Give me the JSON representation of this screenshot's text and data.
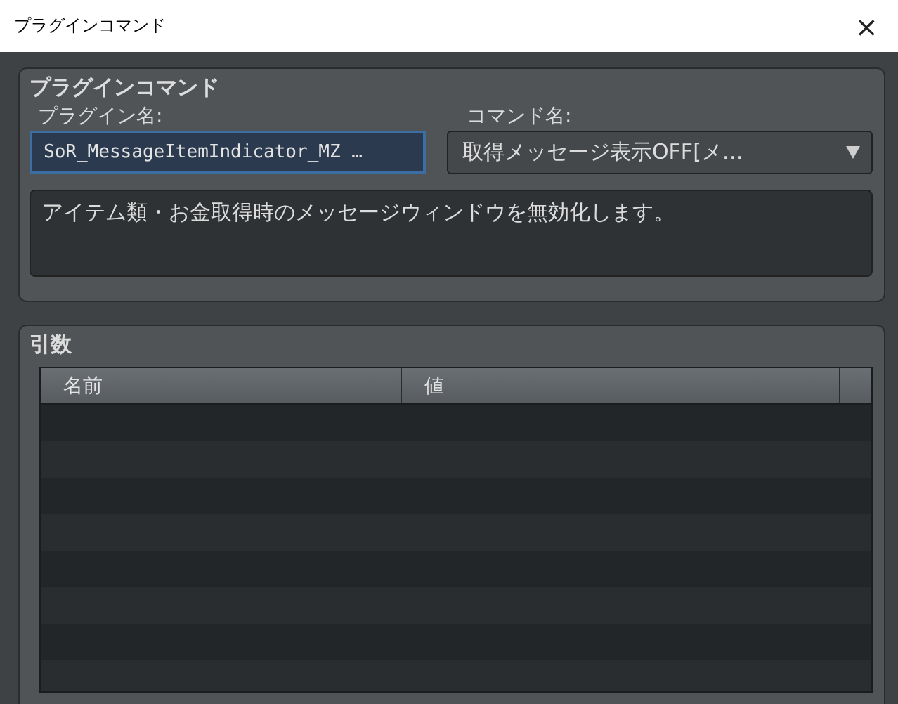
{
  "window": {
    "title": "プラグインコマンド",
    "close": "×"
  },
  "plugin_command": {
    "title": "プラグインコマンド",
    "plugin_label": "プラグイン名:",
    "plugin_value": "SoR_MessageItemIndicator_MZ …",
    "command_label": "コマンド名:",
    "command_value": "取得メッセージ表示OFF[メ…",
    "description": "アイテム類・お金取得時のメッセージウィンドウを無効化します。"
  },
  "arguments": {
    "title": "引数",
    "table": {
      "columns": [
        "名前",
        "値"
      ]
    }
  }
}
